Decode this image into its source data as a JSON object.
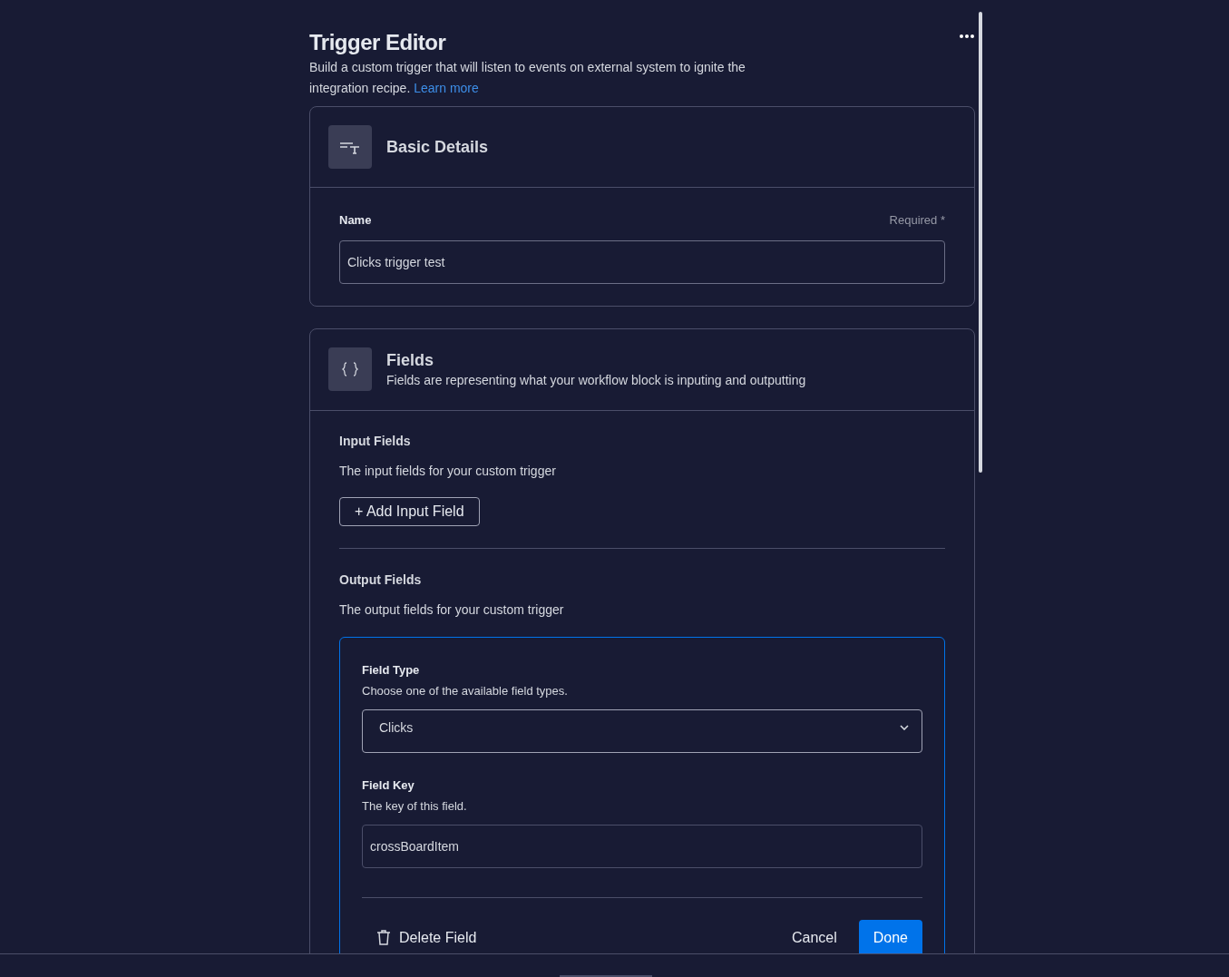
{
  "header": {
    "title": "Trigger Editor",
    "description": "Build a custom trigger that will listen to events on external system to ignite the integration recipe.",
    "link": "Learn more"
  },
  "basic_details": {
    "title": "Basic Details",
    "name_field": {
      "label": "Name",
      "required": "Required *",
      "value": "Clicks trigger test"
    }
  },
  "fields": {
    "title": "Fields",
    "description": "Fields are representing what your workflow block is inputing and outputting",
    "input": {
      "title": "Input Fields",
      "description": "The input fields for your custom trigger",
      "add_button": "+ Add Input Field"
    },
    "output": {
      "title": "Output Fields",
      "description": "The output fields for your custom trigger",
      "editor": {
        "field_type": {
          "label": "Field Type",
          "description": "Choose one of the available field types.",
          "value": "Clicks"
        },
        "field_key": {
          "label": "Field Key",
          "description": "The key of this field.",
          "value": "crossBoardItem"
        },
        "delete_button": "Delete Field",
        "cancel_button": "Cancel",
        "done_button": "Done"
      }
    }
  }
}
